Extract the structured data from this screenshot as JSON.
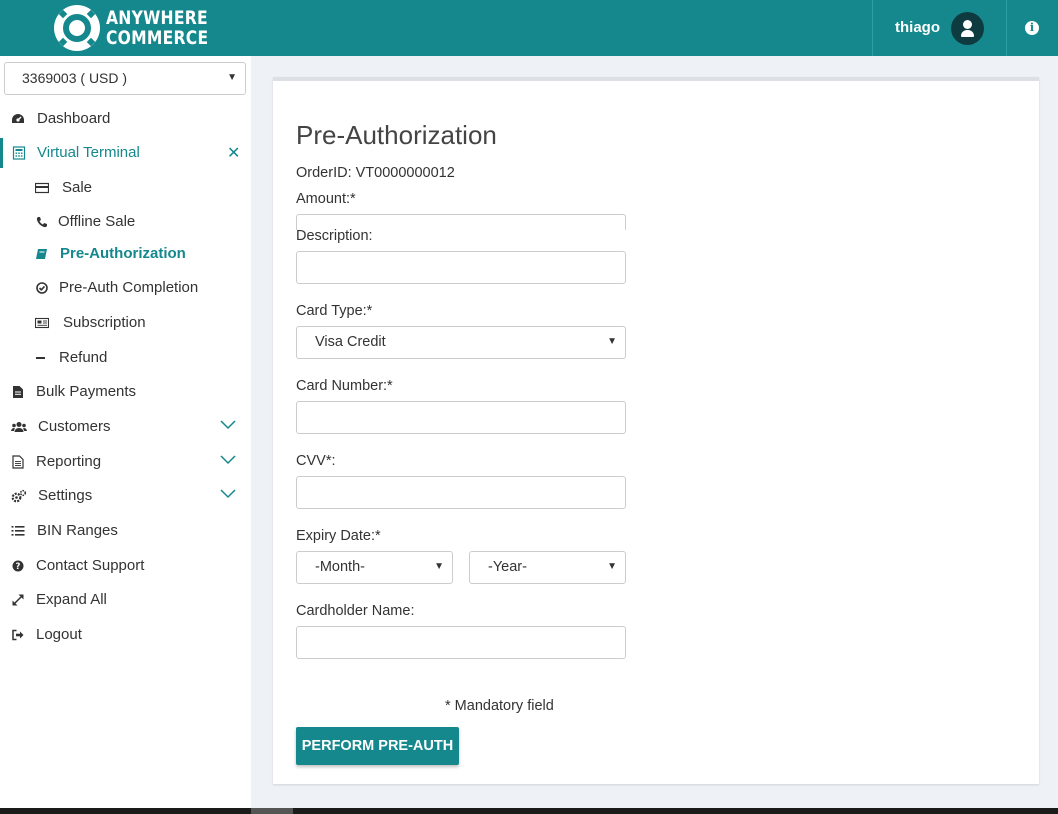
{
  "header": {
    "brand_line1": "ANYWHERE",
    "brand_line2": "COMMERCE",
    "username": "thiago",
    "icons": [
      "logo-icon",
      "user-icon",
      "info-icon"
    ],
    "color": "#14888c"
  },
  "sidebar": {
    "account_select": "3369003 ( USD )",
    "items": [
      {
        "label": "Dashboard",
        "icon": "dashboard-icon"
      },
      {
        "label": "Virtual Terminal",
        "icon": "calculator-icon",
        "expanded": true
      },
      {
        "label": "Sale",
        "icon": "credit-card-icon"
      },
      {
        "label": "Offline Sale",
        "icon": "phone-icon"
      },
      {
        "label": "Pre-Authorization",
        "icon": "book-icon",
        "current": true
      },
      {
        "label": "Pre-Auth Completion",
        "icon": "check-circle-icon"
      },
      {
        "label": "Subscription",
        "icon": "newspaper-icon"
      },
      {
        "label": "Refund",
        "icon": "minus-icon"
      },
      {
        "label": "Bulk Payments",
        "icon": "file-icon"
      },
      {
        "label": "Customers",
        "icon": "users-icon"
      },
      {
        "label": "Reporting",
        "icon": "report-icon"
      },
      {
        "label": "Settings",
        "icon": "cogs-icon"
      },
      {
        "label": "BIN Ranges",
        "icon": "list-icon"
      },
      {
        "label": "Contact Support",
        "icon": "question-circle-icon"
      },
      {
        "label": "Expand All",
        "icon": "expand-icon"
      },
      {
        "label": "Logout",
        "icon": "sign-out-icon"
      }
    ]
  },
  "form": {
    "title": "Pre-Authorization",
    "order_id": "OrderID: VT0000000012",
    "amount_label": "Amount:*",
    "amount_value": "",
    "description_label": "Description:",
    "description_value": "",
    "card_type_label": "Card Type:*",
    "card_type_value": "Visa Credit",
    "card_number_label": "Card Number:*",
    "card_number_value": "",
    "cvv_label": "CVV*:",
    "cvv_value": "",
    "expiry_label": "Expiry Date:*",
    "expiry_month": "-Month-",
    "expiry_year": "-Year-",
    "cardholder_label": "Cardholder Name:",
    "cardholder_value": "",
    "mandatory_note": "* Mandatory field",
    "submit_label": "PERFORM PRE-AUTH"
  }
}
